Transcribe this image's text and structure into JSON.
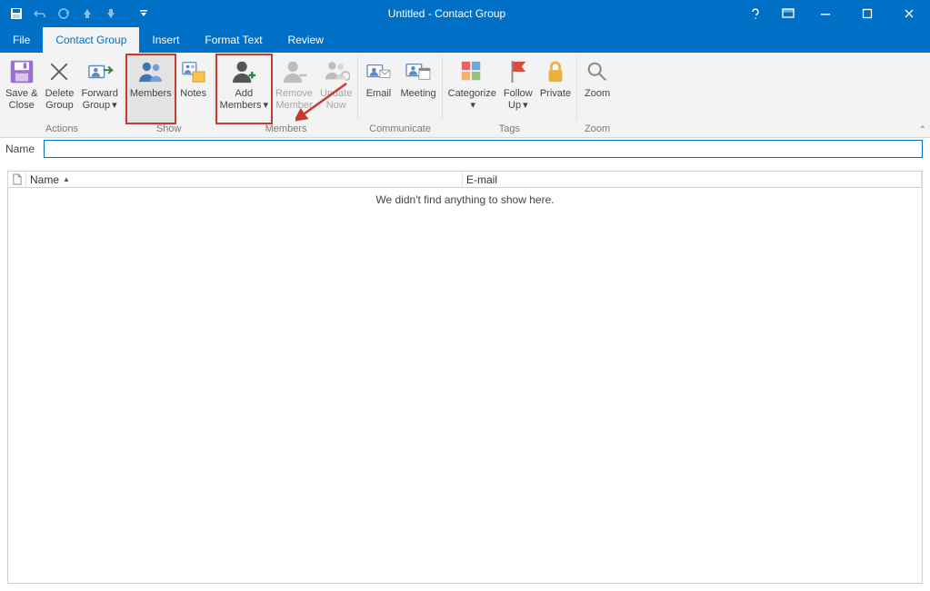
{
  "window": {
    "title": "Untitled - Contact Group"
  },
  "qat": {
    "save_tip": "Save",
    "undo_tip": "Undo",
    "redo_tip": "Redo",
    "prev_tip": "Previous",
    "next_tip": "Next",
    "customize_tip": "Customize"
  },
  "tabs": {
    "file": "File",
    "contact_group": "Contact Group",
    "insert": "Insert",
    "format_text": "Format Text",
    "review": "Review"
  },
  "ribbon": {
    "groups": {
      "actions": "Actions",
      "show": "Show",
      "members": "Members",
      "communicate": "Communicate",
      "tags": "Tags",
      "zoom": "Zoom"
    },
    "buttons": {
      "save_close": "Save &\nClose",
      "delete_group": "Delete\nGroup",
      "forward_group": "Forward\nGroup",
      "members": "Members",
      "notes": "Notes",
      "add_members": "Add\nMembers",
      "remove_member": "Remove\nMember",
      "update_now": "Update\nNow",
      "email": "Email",
      "meeting": "Meeting",
      "categorize": "Categorize",
      "follow_up": "Follow\nUp",
      "private": "Private",
      "zoom": "Zoom"
    }
  },
  "name_row": {
    "label": "Name"
  },
  "list": {
    "col_icon": "",
    "col_name": "Name",
    "col_email": "E-mail",
    "empty": "We didn't find anything to show here."
  },
  "colors": {
    "accent": "#0070c7",
    "highlight": "#c73a2f"
  }
}
